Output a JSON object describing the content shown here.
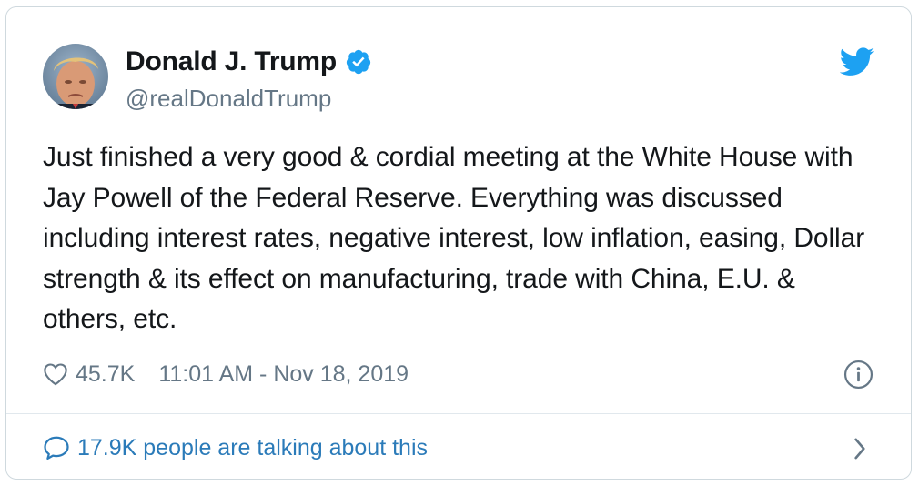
{
  "author": {
    "display_name": "Donald J. Trump",
    "handle": "@realDonaldTrump",
    "verified": true,
    "avatar_icon": "profile-photo"
  },
  "tweet": {
    "text": "Just finished a very good & cordial meeting at the White House with Jay Powell of the Federal Reserve. Everything was discussed including interest rates, negative interest, low inflation, easing, Dollar strength & its effect on manufacturing, trade with China, E.U. & others, etc."
  },
  "meta": {
    "like_count": "45.7K",
    "timestamp": "11:01 AM - Nov 18, 2019"
  },
  "conversation": {
    "label": "17.9K people are talking about this"
  },
  "icons": {
    "brand": "twitter-bird-icon",
    "verified": "verified-badge-icon",
    "like": "heart-icon",
    "info": "info-icon",
    "reply": "speech-bubble-icon",
    "chevron": "chevron-right-icon"
  },
  "colors": {
    "brand_blue": "#1da1f2",
    "link_blue": "#2b7bb9",
    "text_primary": "#14171a",
    "text_secondary": "#657786",
    "border": "#cfd9de"
  }
}
